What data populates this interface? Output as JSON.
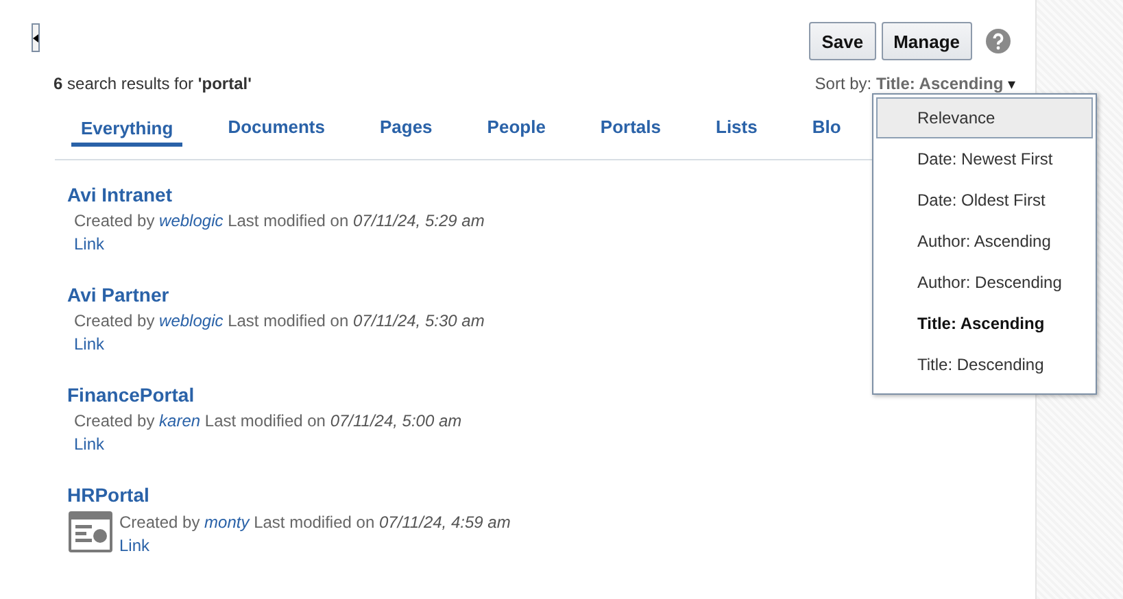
{
  "toolbar": {
    "buttons": [
      "Save",
      "Manage"
    ]
  },
  "summary": {
    "count": "6",
    "text": "search results for",
    "query": "'portal'"
  },
  "sort": {
    "label": "Sort by:",
    "value": "Title: Ascending",
    "caret": "▾"
  },
  "tabs": [
    {
      "label": "Everything",
      "selected": true
    },
    {
      "label": "Documents",
      "selected": false
    },
    {
      "label": "Pages",
      "selected": false
    },
    {
      "label": "People",
      "selected": false
    },
    {
      "label": "Portals",
      "selected": false
    },
    {
      "label": "Lists",
      "selected": false
    },
    {
      "label": "Blo",
      "selected": false
    }
  ],
  "results": [
    {
      "kind": "plain",
      "title": "Avi Intranet",
      "created_by": "Created by",
      "author": "weblogic",
      "modified_label": "Last modified on",
      "date": "07/11/24, 5:29 am",
      "link": "Link"
    },
    {
      "kind": "plain",
      "title": "Avi Partner",
      "created_by": "Created by",
      "author": "weblogic",
      "modified_label": "Last modified on",
      "date": "07/11/24, 5:30 am",
      "link": "Link"
    },
    {
      "kind": "plain",
      "title": "FinancePortal",
      "created_by": "Created by",
      "author": "karen",
      "modified_label": "Last modified on",
      "date": "07/11/24, 5:00 am",
      "link": "Link"
    },
    {
      "kind": "thumbnail",
      "title": "HRPortal",
      "created_by": "Created by",
      "author": "monty",
      "modified_label": "Last modified on",
      "date": "07/11/24, 4:59 am",
      "link": "Link"
    }
  ],
  "sort_menu": [
    {
      "label": "Relevance",
      "highlighted": true,
      "selected": false
    },
    {
      "label": "Date: Newest First",
      "highlighted": false,
      "selected": false
    },
    {
      "label": "Date: Oldest First",
      "highlighted": false,
      "selected": false
    },
    {
      "label": "Author: Ascending",
      "highlighted": false,
      "selected": false
    },
    {
      "label": "Author: Descending",
      "highlighted": false,
      "selected": false
    },
    {
      "label": "Title: Ascending",
      "highlighted": false,
      "selected": true
    },
    {
      "label": "Title: Descending",
      "highlighted": false,
      "selected": false
    }
  ]
}
